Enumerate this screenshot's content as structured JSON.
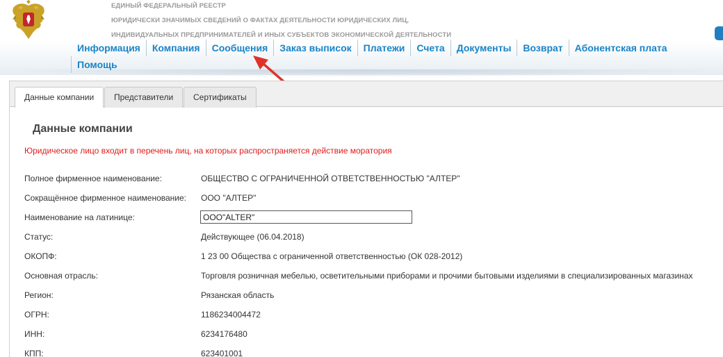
{
  "header": {
    "registry_line1": "ЕДИНЫЙ ФЕДЕРАЛЬНЫЙ РЕЕСТР",
    "registry_line2": "ЮРИДИЧЕСКИ ЗНАЧИМЫХ СВЕДЕНИЙ О ФАКТАХ ДЕЯТЕЛЬНОСТИ ЮРИДИЧЕСКИХ ЛИЦ,",
    "registry_line3": "ИНДИВИДУАЛЬНЫХ ПРЕДПРИНИМАТЕЛЕЙ И ИНЫХ СУБЪЕКТОВ ЭКОНОМИЧЕСКОЙ ДЕЯТЕЛЬНОСТИ",
    "emblem_icon": "coat-of-arms-icon"
  },
  "nav": {
    "items": [
      "Информация",
      "Компания",
      "Сообщения",
      "Заказ выписок",
      "Платежи",
      "Счета",
      "Документы",
      "Возврат",
      "Абонентская плата"
    ],
    "items_row2": [
      "Помощь"
    ],
    "link_color": "#1a84c7"
  },
  "annotation": {
    "arrow_icon": "red-arrow-icon",
    "color": "#e0322b"
  },
  "tabs": [
    {
      "label": "Данные компании",
      "active": true
    },
    {
      "label": "Представители",
      "active": false
    },
    {
      "label": "Сертификаты",
      "active": false
    }
  ],
  "company": {
    "section_title": "Данные компании",
    "warning": "Юридическое лицо входит в перечень лиц, на которых распространяется действие моратория",
    "warning_color": "#e01b1b",
    "fields": [
      {
        "label": "Полное фирменное наименование:",
        "value": "ОБЩЕСТВО С ОГРАНИЧЕННОЙ ОТВЕТСТВЕННОСТЬЮ \"АЛТЕР\""
      },
      {
        "label": "Сокращённое фирменное наименование:",
        "value": "ООО \"АЛТЕР\""
      },
      {
        "label": "Наименование на латинице:",
        "value": "ООО\"ALTER\""
      },
      {
        "label": "Статус:",
        "value": "Действующее (06.04.2018)"
      },
      {
        "label": "ОКОПФ:",
        "value": "1 23 00 Общества с ограниченной ответственностью (ОК 028-2012)"
      },
      {
        "label": "Основная отрасль:",
        "value": "Торговля розничная мебелью, осветительными приборами и прочими бытовыми изделиями в специализированных магазинах"
      },
      {
        "label": "Регион:",
        "value": "Рязанская область"
      },
      {
        "label": "ОГРН:",
        "value": "1186234004472"
      },
      {
        "label": "ИНН:",
        "value": "6234176480"
      },
      {
        "label": "КПП:",
        "value": "623401001"
      }
    ]
  }
}
